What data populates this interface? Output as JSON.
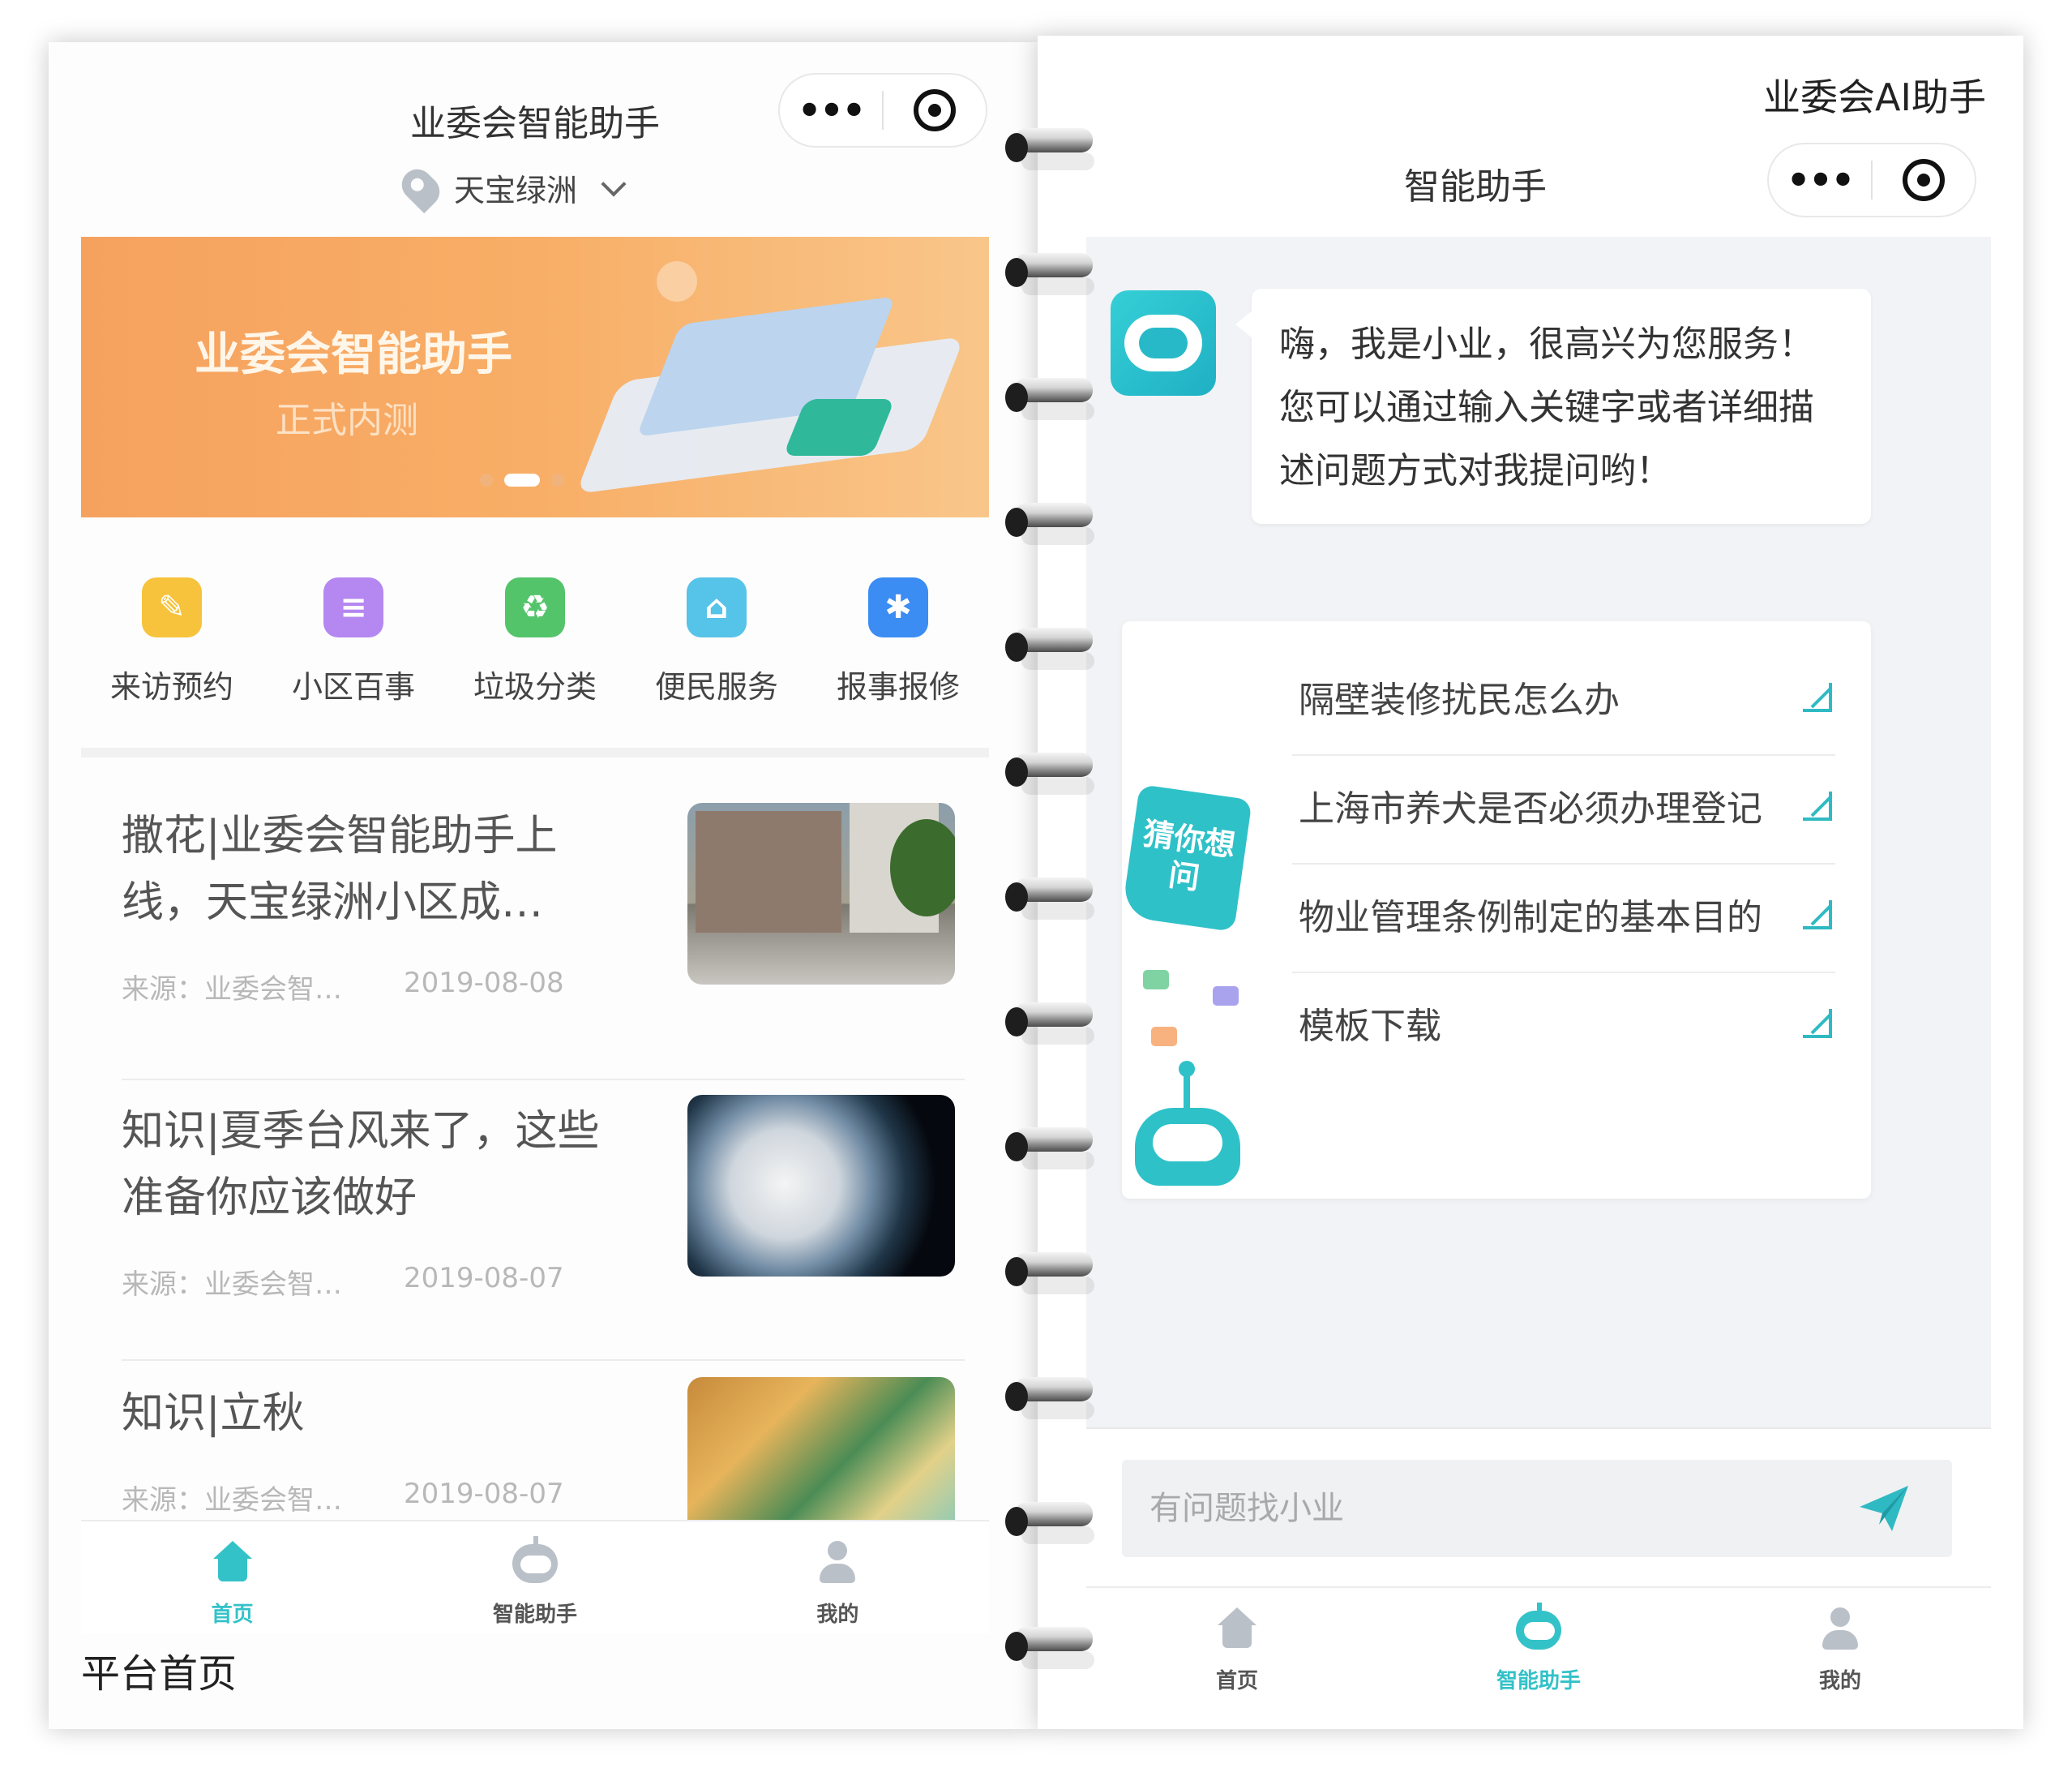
{
  "left": {
    "title": "业委会智能助手",
    "capsule": {
      "more": "•••"
    },
    "location": "天宝绿洲",
    "banner": {
      "title": "业委会智能助手",
      "subtitle": "正式内测"
    },
    "shortcuts": [
      {
        "label": "来访预约",
        "color": "#f7c33c",
        "icon": "visit-icon"
      },
      {
        "label": "小区百事",
        "color": "#b587f0",
        "icon": "document-icon"
      },
      {
        "label": "垃圾分类",
        "color": "#54c46a",
        "icon": "recycle-icon"
      },
      {
        "label": "便民服务",
        "color": "#56c3e8",
        "icon": "service-icon"
      },
      {
        "label": "报事报修",
        "color": "#3b8cf3",
        "icon": "repair-icon"
      }
    ],
    "news": [
      {
        "title": "撒花|业委会智能助手上线，天宝绿洲小区成…",
        "source": "来源：业委会智…",
        "date": "2019-08-08"
      },
      {
        "title": "知识|夏季台风来了，这些准备你应该做好",
        "source": "来源：业委会智…",
        "date": "2019-08-07"
      },
      {
        "title": "知识|立秋",
        "source": "来源：业委会智…",
        "date": "2019-08-07"
      }
    ],
    "tabs": [
      {
        "label": "首页"
      },
      {
        "label": "智能助手"
      },
      {
        "label": "我的"
      }
    ],
    "caption": "平台首页"
  },
  "right": {
    "caption": "业委会AI助手",
    "title": "智能助手",
    "capsule": {
      "more": "•••"
    },
    "greeting": "嗨，我是小业，很高兴为您服务！您可以通过输入关键字或者详细描述问题方式对我提问哟！",
    "guess_badge": "猜你想问",
    "questions": [
      "隔壁装修扰民怎么办",
      "上海市养犬是否必须办理登记",
      "物业管理条例制定的基本目的",
      "模板下载"
    ],
    "input_placeholder": "有问题找小业",
    "tabs": [
      {
        "label": "首页"
      },
      {
        "label": "智能助手"
      },
      {
        "label": "我的"
      }
    ],
    "accent": "#33c2c8"
  }
}
